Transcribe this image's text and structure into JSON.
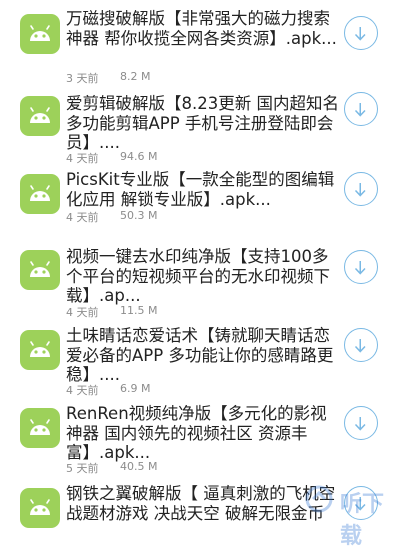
{
  "items": [
    {
      "title": "万磁搜破解版【非常强大的磁力搜索神器 帮你收揽全网各类资源】.apk...",
      "time": "3 天前",
      "size": "8.2 M"
    },
    {
      "title": "爱剪辑破解版【8.23更新 国内超知名多功能剪辑APP 手机号注册登陆即会员】....",
      "time": "4 天前",
      "size": "94.6 M"
    },
    {
      "title": "PicsKit专业版【一款全能型的图编辑化应用 解锁专业版】.apk...",
      "time": "4 天前",
      "size": "50.3 M"
    },
    {
      "title": "视频一键去水印纯净版【支持100多个平台的短视频平台的无水印视频下载】.ap...",
      "time": "4 天前",
      "size": "11.5 M"
    },
    {
      "title": "土味睛话恋爱话术【铸就聊天睛话恋爱必备的APP 多功能让你的感睛路更稳】....",
      "time": "4 天前",
      "size": "6.9 M"
    },
    {
      "title": "RenRen视频纯净版【多元化的影视神器 国内领先的视频社区 资源丰富】.apk...",
      "time": "5 天前",
      "size": "40.5 M"
    },
    {
      "title": "钢铁之翼破解版【 逼真刺激的飞机空战题材游戏 决战天空 破解无限金币",
      "time": "",
      "size": ""
    }
  ],
  "icons": {
    "app": "android-icon",
    "download": "download-arrow-icon"
  },
  "colors": {
    "icon_bg": "#9dd15a",
    "download_accent": "#7ab9e4",
    "meta_text": "#8c8c8c"
  },
  "watermark": {
    "text": "听下载"
  }
}
